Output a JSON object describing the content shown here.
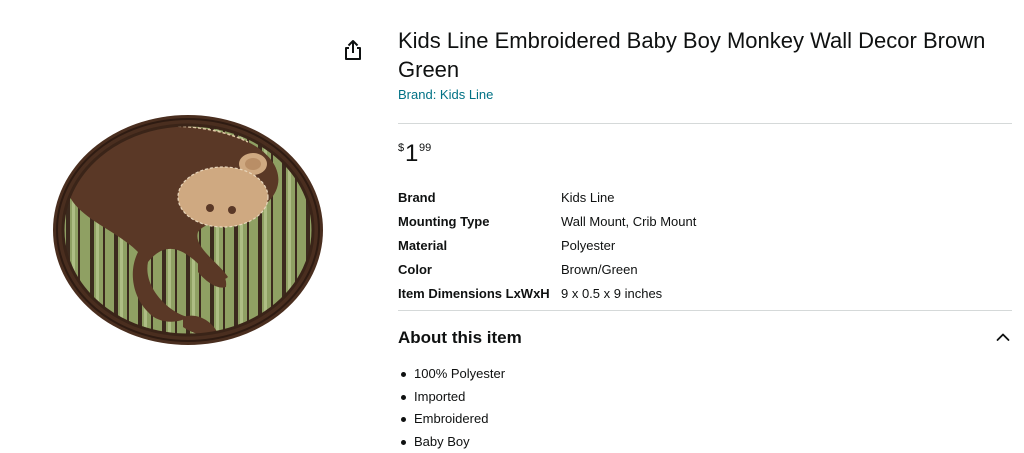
{
  "product": {
    "title": "Kids Line Embroidered Baby Boy Monkey Wall Decor Brown Green",
    "brand_link": "Brand: Kids Line",
    "image_alt": "monkey-wall-decor-image"
  },
  "share": {
    "icon": "share-icon"
  },
  "price": {
    "symbol": "$",
    "whole": "1",
    "fraction": "99"
  },
  "specs": [
    {
      "key": "Brand",
      "value": "Kids Line"
    },
    {
      "key": "Mounting Type",
      "value": "Wall Mount, Crib Mount"
    },
    {
      "key": "Material",
      "value": "Polyester"
    },
    {
      "key": "Color",
      "value": "Brown/Green"
    },
    {
      "key": "Item Dimensions LxWxH",
      "value": "9 x 0.5 x 9 inches"
    }
  ],
  "about": {
    "title": "About this item",
    "toggle_icon": "chevron-up-icon",
    "bullets": [
      "100% Polyester",
      "Imported",
      "Embroidered",
      "Baby Boy"
    ]
  },
  "colors": {
    "link": "#007185",
    "text": "#0f1111",
    "divider": "#d5d9d9"
  }
}
